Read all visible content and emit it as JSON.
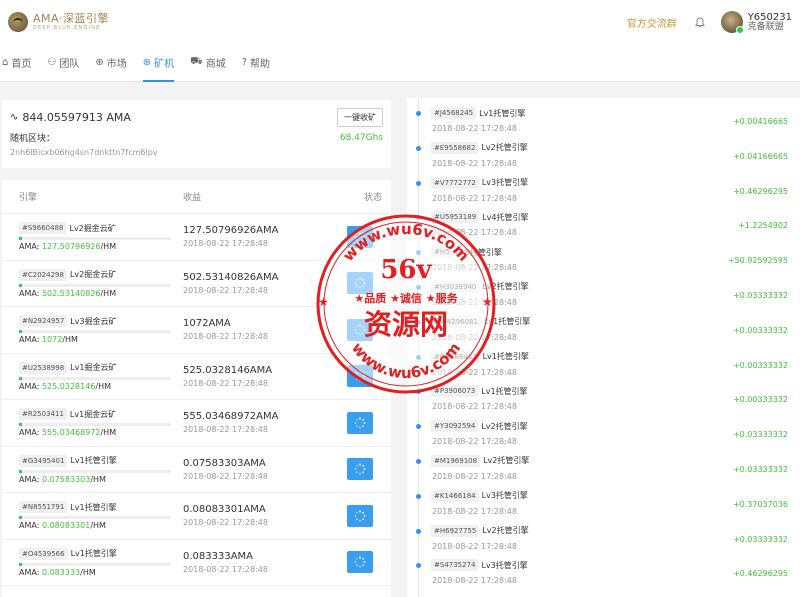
{
  "header": {
    "logo_title": "AMA·深蓝引擎",
    "logo_sub": "DEEP BLUE ENGINE",
    "official_link": "官方交流群",
    "username": "Y650231",
    "team": "克备联盟"
  },
  "nav": [
    {
      "icon": "⌂",
      "icon_name": "home-icon",
      "label": "首页",
      "active": false
    },
    {
      "icon": "⚇",
      "icon_name": "team-icon",
      "label": "团队",
      "active": false
    },
    {
      "icon": "⊕",
      "icon_name": "globe-icon",
      "label": "市场",
      "active": false
    },
    {
      "icon": "⊕",
      "icon_name": "globe-icon",
      "label": "矿机",
      "active": true
    },
    {
      "icon": "⛟",
      "icon_name": "cart-icon",
      "label": "商城",
      "active": false
    },
    {
      "icon": "?",
      "icon_name": "help-icon",
      "label": "帮助",
      "active": false
    }
  ],
  "summary": {
    "balance": "844.05597913 AMA",
    "collect_button": "一键收矿",
    "block_label": "随机区块：",
    "hashrate": "68.47Ghs",
    "hash": "2nh6lBicxb06hg4sn7dnkttn7fcm6lpv"
  },
  "engines": {
    "headers": {
      "engine": "引擎",
      "income": "收益",
      "status": "状态"
    },
    "rows": [
      {
        "id": "#S9660488",
        "name": "Lv2掘金云矿",
        "rate_label": "AMA:",
        "rate": "127.50796926",
        "unit": "/HM",
        "amount": "127.50796926AMA",
        "time": "2018-08-22 17:28:48",
        "progress": 0.02
      },
      {
        "id": "#C2024298",
        "name": "Lv2掘金云矿",
        "rate_label": "AMA:",
        "rate": "502.53140826",
        "unit": "/HM",
        "amount": "502.53140826AMA",
        "time": "2018-08-22 17:28:48",
        "progress": 0.02
      },
      {
        "id": "#N2924957",
        "name": "Lv3掘金云矿",
        "rate_label": "AMA:",
        "rate": "1072",
        "unit": "/HM",
        "amount": "1072AMA",
        "time": "2018-08-22 17:28:48",
        "progress": 0.02
      },
      {
        "id": "#U2538998",
        "name": "Lv1掘金云矿",
        "rate_label": "AMA:",
        "rate": "525.0328146",
        "unit": "/HM",
        "amount": "525.0328146AMA",
        "time": "2018-08-22 17:28:48",
        "progress": 0.02
      },
      {
        "id": "#R2503411",
        "name": "Lv1掘金云矿",
        "rate_label": "AMA:",
        "rate": "555.03468972",
        "unit": "/HM",
        "amount": "555.03468972AMA",
        "time": "2018-08-22 17:28:48",
        "progress": 0.02
      },
      {
        "id": "#G3495401",
        "name": "Lv1托管引擎",
        "rate_label": "AMA:",
        "rate": "0.07583303",
        "unit": "/HM",
        "amount": "0.07583303AMA",
        "time": "2018-08-22 17:28:48",
        "progress": 0.02
      },
      {
        "id": "#N8551791",
        "name": "Lv1托管引擎",
        "rate_label": "AMA:",
        "rate": "0.08083301",
        "unit": "/HM",
        "amount": "0.08083301AMA",
        "time": "2018-08-22 17:28:48",
        "progress": 0.02
      },
      {
        "id": "#O4539566",
        "name": "Lv1托管引擎",
        "rate_label": "AMA:",
        "rate": "0.083333",
        "unit": "/HM",
        "amount": "0.083333AMA",
        "time": "2018-08-22 17:28:48",
        "progress": 0.02
      }
    ]
  },
  "timeline": [
    {
      "id": "#J4568245",
      "name": "Lv1托管引擎",
      "time": "2018-08-22 17:28:48",
      "amount": "+0.00416665"
    },
    {
      "id": "#E9558682",
      "name": "Lv2托管引擎",
      "time": "2018-08-22 17:28:48",
      "amount": "+0.04166665"
    },
    {
      "id": "#V7772772",
      "name": "Lv3托管引擎",
      "time": "2018-08-22 17:28:48",
      "amount": "+0.46296295"
    },
    {
      "id": "#U5953189",
      "name": "Lv4托管引擎",
      "time": "2018-08-22 17:28:48",
      "amount": "+1.2254902"
    },
    {
      "id": "#H5",
      "name": "Lv5托管引擎",
      "time": "2018-08-22 17:28:48",
      "amount": "+50.92592595"
    },
    {
      "id": "#H3038940",
      "name": "Lv2托管引擎",
      "time": "2018-08-22 17:28:48",
      "amount": "+0.03333332"
    },
    {
      "id": "#W4296081",
      "name": "Lv1托管引擎",
      "time": "2018-08-22 17:28:48",
      "amount": "+0.00333332"
    },
    {
      "id": "#O5588432",
      "name": "Lv1托管引擎",
      "time": "2018-08-22 17:28:48",
      "amount": "+0.00333332"
    },
    {
      "id": "#P3906073",
      "name": "Lv1托管引擎",
      "time": "2018-08-22 17:28:48",
      "amount": "+0.00333332"
    },
    {
      "id": "#Y3092594",
      "name": "Lv2托管引擎",
      "time": "2018-08-22 17:28:48",
      "amount": "+0.03333332"
    },
    {
      "id": "#M1969108",
      "name": "Lv2托管引擎",
      "time": "2018-08-22 17:28:48",
      "amount": "+0.03333332"
    },
    {
      "id": "#K1466184",
      "name": "Lv3托管引擎",
      "time": "2018-08-22 17:28:48",
      "amount": "+0.37037036"
    },
    {
      "id": "#H6927755",
      "name": "Lv2托管引擎",
      "time": "2018-08-22 17:28:48",
      "amount": "+0.03333332"
    },
    {
      "id": "#S4735274",
      "name": "Lv3托管引擎",
      "time": "2018-08-22 17:28:48",
      "amount": "+0.46296295"
    }
  ],
  "watermark": {
    "url_top": "www.wu6v.com",
    "big": "56v",
    "tags": "★品质 ★诚信 ★服务",
    "name": "资源网",
    "url_bottom": "www.wu6v.com",
    "color": "#e02020"
  },
  "colors": {
    "accent": "#3a8ee6",
    "green": "#44c03c",
    "gold": "#c49a3c"
  }
}
